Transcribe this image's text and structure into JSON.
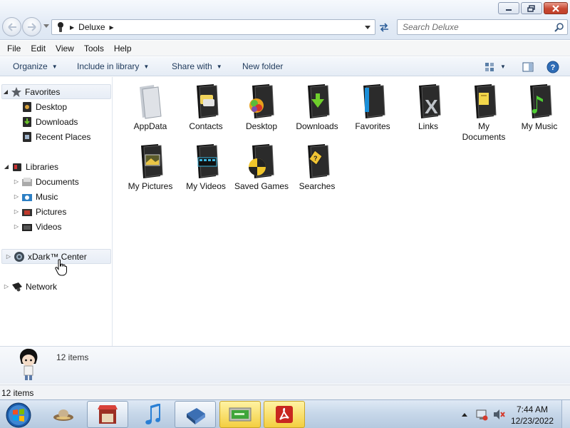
{
  "window": {
    "address_crumbs": [
      "Deluxe"
    ],
    "search_placeholder": "Search Deluxe"
  },
  "menu": [
    "File",
    "Edit",
    "View",
    "Tools",
    "Help"
  ],
  "command_bar": {
    "organize": "Organize",
    "include_in_library": "Include in library",
    "share_with": "Share with",
    "new_folder": "New folder"
  },
  "nav": {
    "favorites": {
      "label": "Favorites",
      "items": [
        "Desktop",
        "Downloads",
        "Recent Places"
      ]
    },
    "libraries": {
      "label": "Libraries",
      "items": [
        "Documents",
        "Music",
        "Pictures",
        "Videos"
      ]
    },
    "xdark_center": "xDark™ Center",
    "network": "Network"
  },
  "files": [
    {
      "label": "AppData",
      "icon": "folder-icon-plain"
    },
    {
      "label": "Contacts",
      "icon": "contacts-folder-icon"
    },
    {
      "label": "Desktop",
      "icon": "desktop-folder-icon"
    },
    {
      "label": "Downloads",
      "icon": "downloads-folder-icon"
    },
    {
      "label": "Favorites",
      "icon": "favorites-folder-icon"
    },
    {
      "label": "Links",
      "icon": "links-folder-icon"
    },
    {
      "label": "My Documents",
      "icon": "documents-folder-icon"
    },
    {
      "label": "My Music",
      "icon": "music-folder-icon"
    },
    {
      "label": "My Pictures",
      "icon": "pictures-folder-icon"
    },
    {
      "label": "My Videos",
      "icon": "videos-folder-icon"
    },
    {
      "label": "Saved Games",
      "icon": "saved-games-folder-icon"
    },
    {
      "label": "Searches",
      "icon": "searches-folder-icon"
    }
  ],
  "details_pane": {
    "count": "12 items"
  },
  "status_bar": {
    "text": "12 items"
  },
  "taskbar": {
    "time": "7:44 AM",
    "date": "12/23/2022"
  },
  "colors": {
    "command_text": "#1e395b",
    "accent_blue": "#3c7fc1",
    "close_red": "#c74832"
  }
}
